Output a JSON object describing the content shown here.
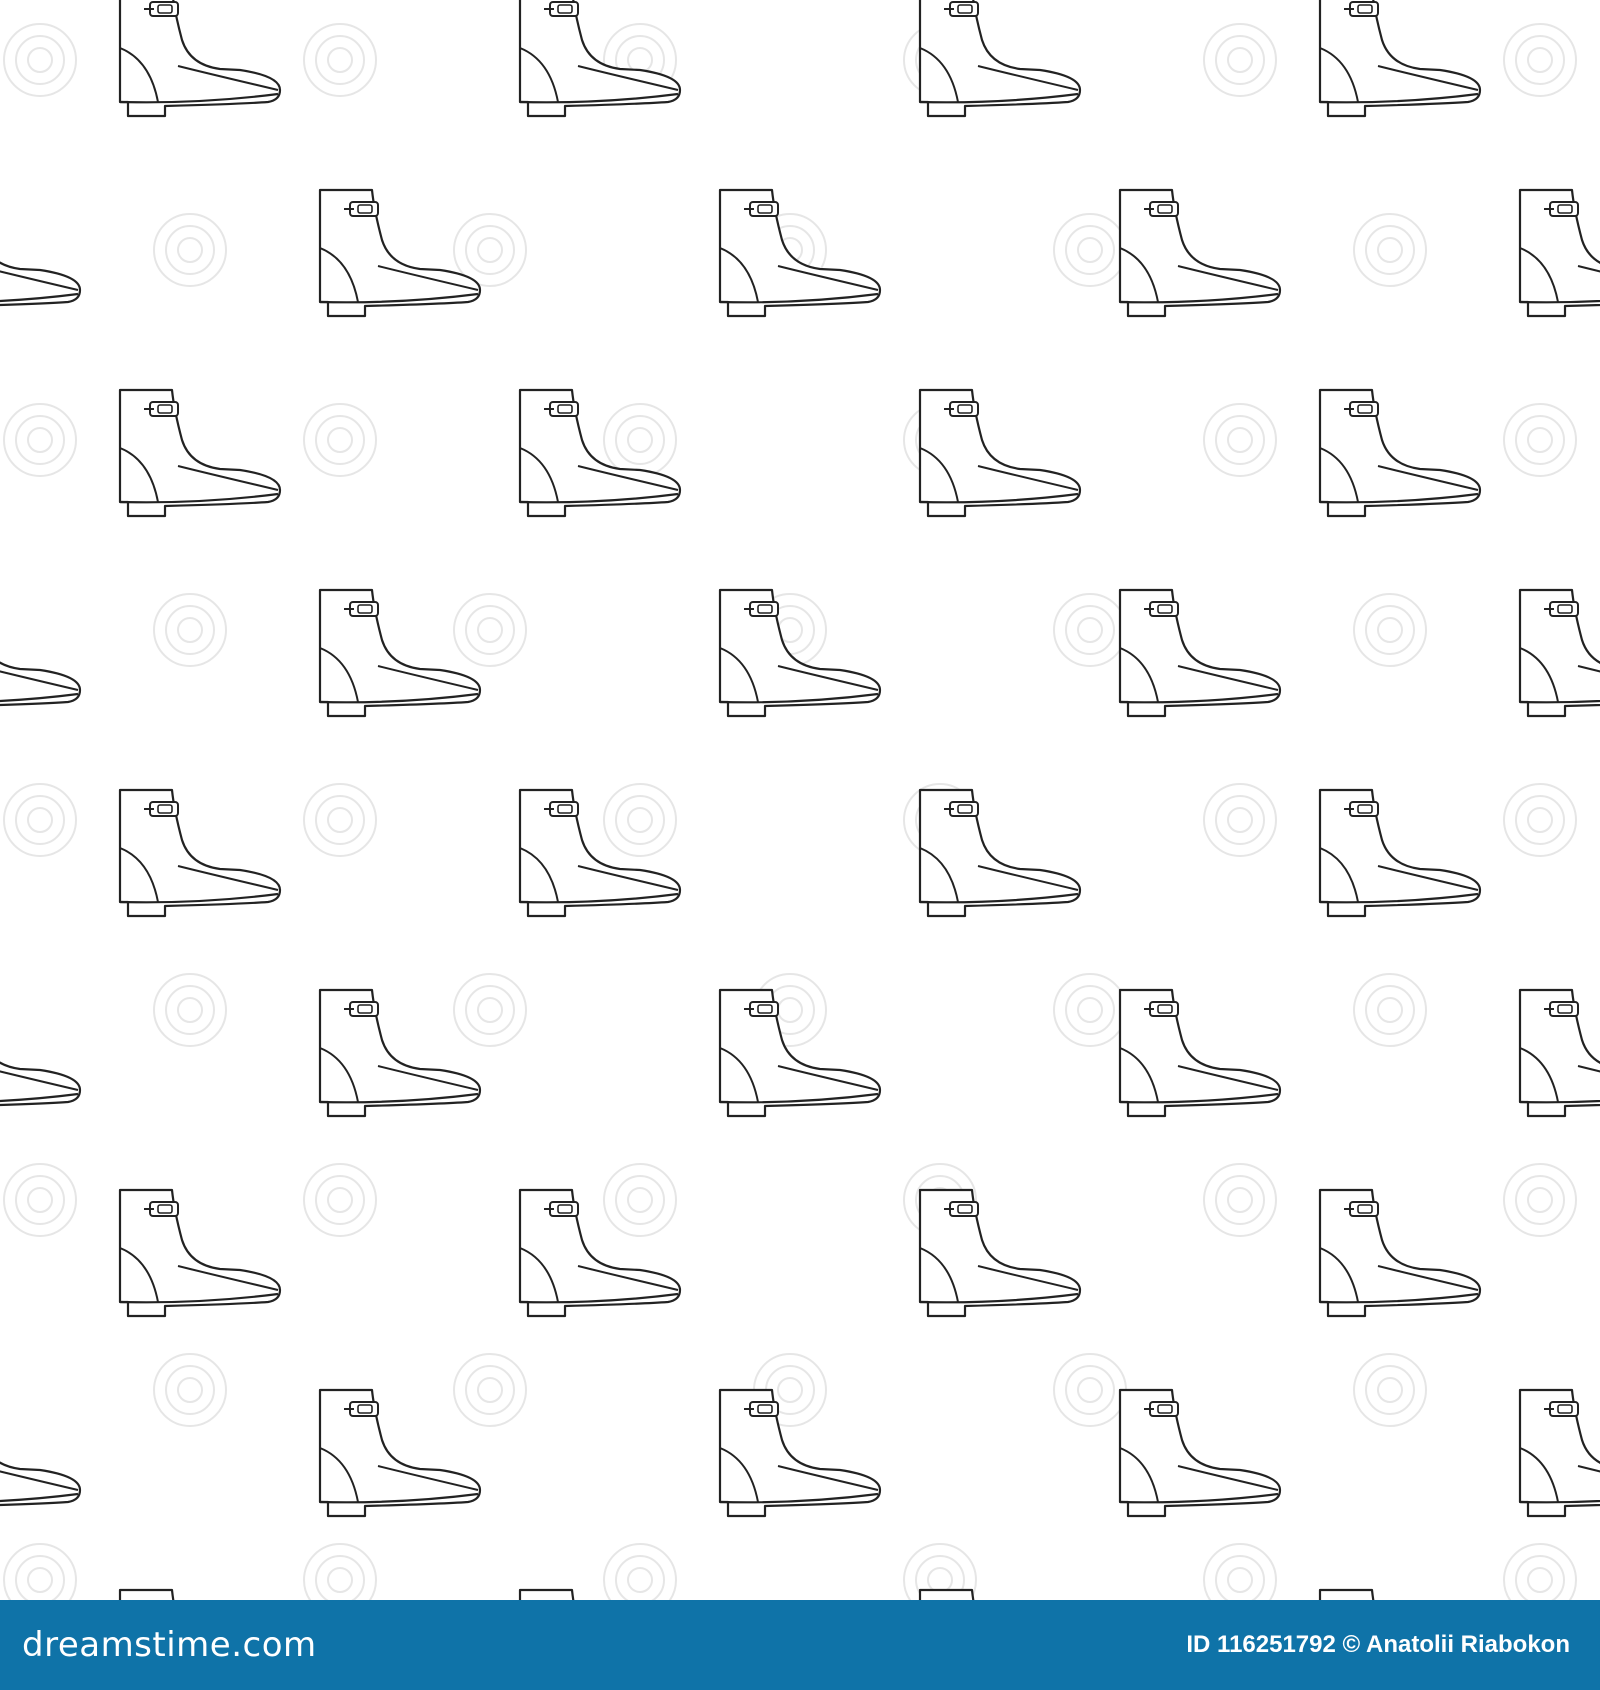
{
  "image": {
    "subject": "boot-outline-pattern",
    "stroke_color": "#222222",
    "background_color": "#ffffff",
    "watermark_text": "dreamstime"
  },
  "footer": {
    "brand": "dreamstime.com",
    "id_label": "ID",
    "id_value": "116251792",
    "copyright_symbol": "©",
    "author": "Anatolii Riabokon",
    "bar_color": "#0f73a8"
  }
}
